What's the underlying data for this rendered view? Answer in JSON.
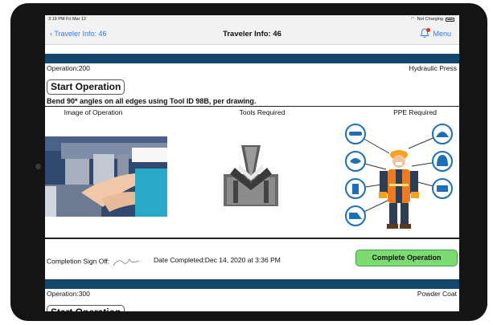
{
  "status_bar": {
    "time": "3:19 PM",
    "date": "Fri Mar 12",
    "charging": "Not Charging"
  },
  "nav": {
    "back_label": "Traveler Info: 46",
    "title": "Traveler Info: 46",
    "menu_label": "Menu"
  },
  "operations": [
    {
      "label": "Operation:200",
      "machine": "Hydraulic Press",
      "start_label": "Start Operation",
      "instructions": "Bend 90* angles on all edges using Tool ID 98B, per drawing.",
      "columns": [
        "Image of Operation",
        "Tools Required",
        "PPE Required"
      ],
      "signoff_label": "Completion Sign Off:",
      "date_completed": "Date Completed:Dec 14, 2020 at 3:36 PM",
      "complete_label": "Complete Operation"
    },
    {
      "label": "Operation:300",
      "machine": "Powder Coat",
      "start_label": "Start Operation"
    }
  ],
  "colors": {
    "accent": "#2f7cf6",
    "band": "#12466a",
    "complete_button": "#7ddb73"
  }
}
